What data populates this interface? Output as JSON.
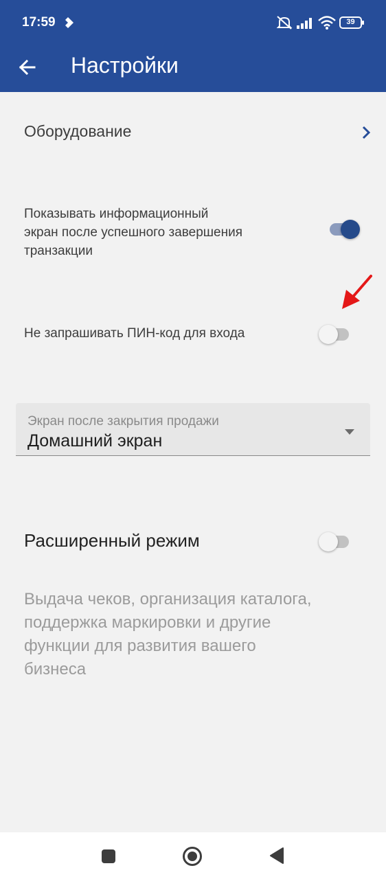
{
  "status_bar": {
    "time": "17:59",
    "battery": "39",
    "icons": [
      "notification-icon",
      "mute-icon",
      "signal-icon",
      "wifi-icon",
      "battery-icon"
    ]
  },
  "app_bar": {
    "title": "Настройки",
    "back_icon": "arrow-left-icon"
  },
  "settings": {
    "equipment_label": "Оборудование",
    "show_info_screen": {
      "label_lines": [
        "Показывать информационный",
        "экран после успешного завершения",
        "транзакции"
      ],
      "enabled": true
    },
    "no_pin": {
      "label": "Не запрашивать ПИН-код для входа",
      "enabled": false
    },
    "after_sale_screen": {
      "label": "Экран после закрытия продажи",
      "value": "Домашний экран"
    },
    "extended_mode": {
      "label": "Расширенный режим",
      "enabled": false,
      "description_lines": [
        "Выдача чеков, организация каталога,",
        "поддержка маркировки и другие",
        "функции для развития вашего",
        "бизнеса"
      ]
    }
  },
  "annotation": {
    "arrow_color": "#e41818"
  },
  "colors": {
    "brand": "#264d99",
    "toggle_on_thumb": "#254a8a",
    "toggle_on_track": "#8b9bbd"
  },
  "nav_bar": {
    "icons": [
      "recents-square-icon",
      "home-circle-icon",
      "back-triangle-icon"
    ]
  }
}
